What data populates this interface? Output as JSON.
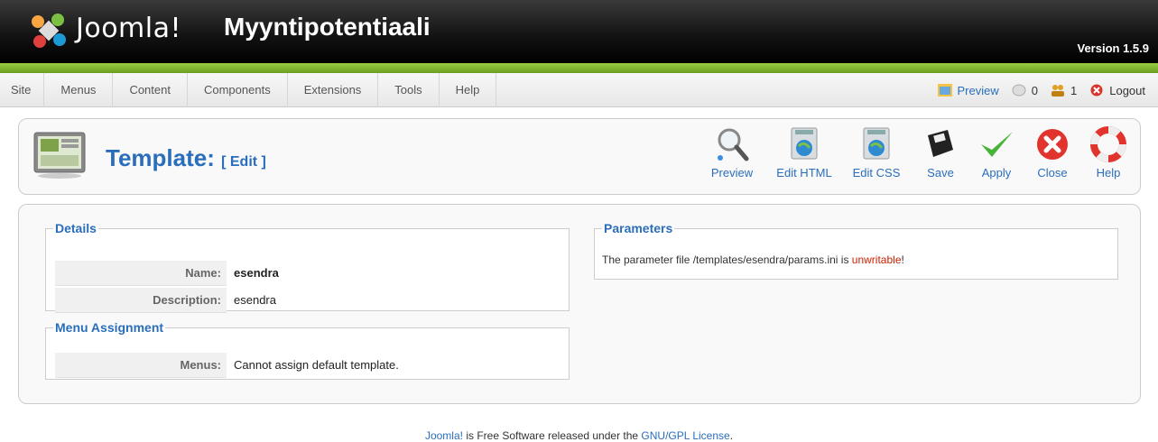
{
  "header": {
    "brand": "Joomla!",
    "site_name": "Myyntipotentiaali",
    "version": "Version 1.5.9"
  },
  "menu": {
    "items": [
      "Site",
      "Menus",
      "Content",
      "Components",
      "Extensions",
      "Tools",
      "Help"
    ]
  },
  "status": {
    "preview": "Preview",
    "messages_count": "0",
    "users_count": "1",
    "logout": "Logout"
  },
  "toolbar": {
    "title": "Template:",
    "subtitle": "[ Edit ]",
    "buttons": [
      {
        "label": "Preview",
        "icon": "magnifier-icon"
      },
      {
        "label": "Edit HTML",
        "icon": "edit-html-icon"
      },
      {
        "label": "Edit CSS",
        "icon": "edit-css-icon"
      },
      {
        "label": "Save",
        "icon": "floppy-disk-icon"
      },
      {
        "label": "Apply",
        "icon": "checkmark-icon"
      },
      {
        "label": "Close",
        "icon": "close-circle-icon"
      },
      {
        "label": "Help",
        "icon": "lifebuoy-icon"
      }
    ]
  },
  "details": {
    "legend": "Details",
    "name_label": "Name:",
    "name_value": "esendra",
    "description_label": "Description:",
    "description_value": "esendra"
  },
  "menu_assignment": {
    "legend": "Menu Assignment",
    "menus_label": "Menus:",
    "menus_value": "Cannot assign default template."
  },
  "parameters": {
    "legend": "Parameters",
    "text_before": "The parameter file /templates/esendra/params.ini is ",
    "text_highlight": "unwritable",
    "text_after": "!"
  },
  "footer": {
    "link1": "Joomla!",
    "middle": " is Free Software released under the ",
    "link2": "GNU/GPL License",
    "end": "."
  },
  "colors": {
    "accent": "#2a6ebb",
    "header_green": "#7fb531",
    "warning_red": "#cc2200"
  }
}
